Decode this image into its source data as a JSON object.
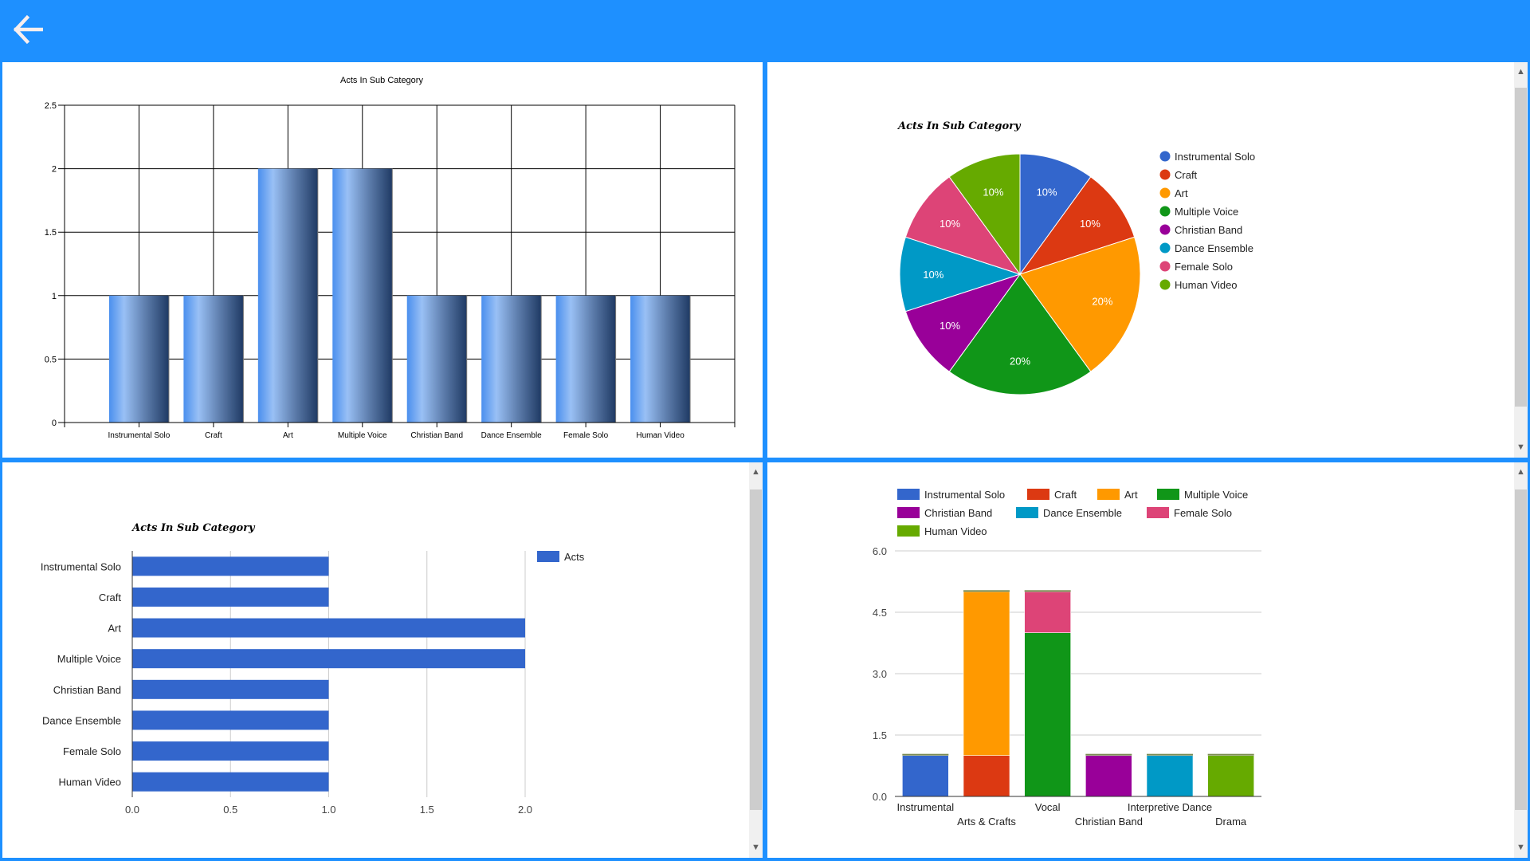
{
  "header": {
    "back_icon": "arrow-left-icon",
    "background": "#1e90ff"
  },
  "colors": {
    "series": [
      "#3366cc",
      "#dc3912",
      "#ff9900",
      "#109618",
      "#990099",
      "#0099c6",
      "#dd4477",
      "#66aa00"
    ],
    "bar_blue": "#3366cc"
  },
  "chart_data": [
    {
      "type": "bar",
      "title": "Acts In Sub Category",
      "categories": [
        "Instrumental Solo",
        "Craft",
        "Art",
        "Multiple Voice",
        "Christian Band",
        "Dance Ensemble",
        "Female Solo",
        "Human Video"
      ],
      "values": [
        1,
        1,
        2,
        2,
        1,
        1,
        1,
        1
      ],
      "xlabel": "",
      "ylabel": "",
      "ylim": [
        0,
        2.5
      ],
      "yticks": [
        "0",
        "0.5",
        "1",
        "1.5",
        "2",
        "2.5"
      ],
      "grid": true
    },
    {
      "type": "pie",
      "title": "Acts In Sub Category",
      "labels": [
        "Instrumental Solo",
        "Craft",
        "Art",
        "Multiple Voice",
        "Christian Band",
        "Dance Ensemble",
        "Female Solo",
        "Human Video"
      ],
      "values": [
        1,
        1,
        2,
        2,
        1,
        1,
        1,
        1
      ],
      "slice_labels": [
        "10%",
        "10%",
        "20%",
        "20%",
        "10%",
        "10%",
        "10%",
        "10%"
      ],
      "legend": "right"
    },
    {
      "type": "bar",
      "orientation": "horizontal",
      "title": "Acts In Sub Category",
      "categories": [
        "Instrumental Solo",
        "Craft",
        "Art",
        "Multiple Voice",
        "Christian Band",
        "Dance Ensemble",
        "Female Solo",
        "Human Video"
      ],
      "series": [
        {
          "name": "Acts",
          "values": [
            1,
            1,
            2,
            2,
            1,
            1,
            1,
            1
          ]
        }
      ],
      "xlim": [
        0,
        2.0
      ],
      "xticks": [
        "0.0",
        "0.5",
        "1.0",
        "1.5",
        "2.0"
      ],
      "legend": "right",
      "grid": true
    },
    {
      "type": "bar",
      "stacked": true,
      "title": "",
      "categories": [
        "Instrumental",
        "Arts & Crafts",
        "Vocal",
        "Christian Band",
        "Interpretive Dance",
        "Drama"
      ],
      "series": [
        {
          "name": "Instrumental Solo",
          "values": [
            1,
            0,
            0,
            0,
            0,
            0
          ]
        },
        {
          "name": "Craft",
          "values": [
            0,
            1,
            0,
            0,
            0,
            0
          ]
        },
        {
          "name": "Art",
          "values": [
            0,
            4,
            0,
            0,
            0,
            0
          ]
        },
        {
          "name": "Multiple Voice",
          "values": [
            0,
            0,
            4,
            0,
            0,
            0
          ]
        },
        {
          "name": "Christian Band",
          "values": [
            0,
            0,
            0,
            1,
            0,
            0
          ]
        },
        {
          "name": "Dance Ensemble",
          "values": [
            0,
            0,
            0,
            0,
            1,
            0
          ]
        },
        {
          "name": "Female Solo",
          "values": [
            0,
            0,
            1,
            0,
            0,
            0
          ]
        },
        {
          "name": "Human Video",
          "values": [
            0,
            0,
            0,
            0,
            0,
            1
          ]
        }
      ],
      "ylim": [
        0,
        6.0
      ],
      "yticks": [
        "0.0",
        "1.5",
        "3.0",
        "4.5",
        "6.0"
      ],
      "legend": "top",
      "grid": true
    }
  ]
}
